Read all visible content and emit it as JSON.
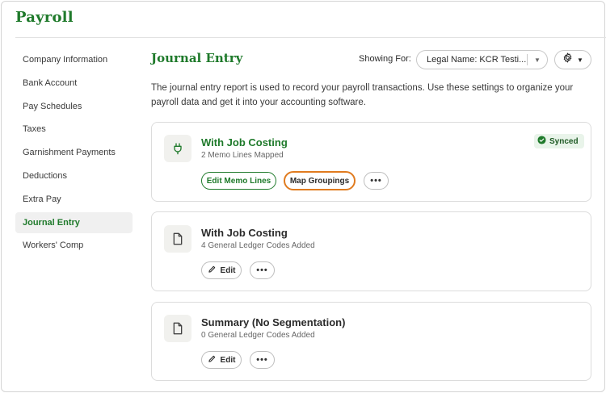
{
  "app": {
    "title": "Payroll"
  },
  "sidebar": {
    "items": [
      {
        "label": "Company Information"
      },
      {
        "label": "Bank Account"
      },
      {
        "label": "Pay Schedules"
      },
      {
        "label": "Taxes"
      },
      {
        "label": "Garnishment Payments"
      },
      {
        "label": "Deductions"
      },
      {
        "label": "Extra Pay"
      },
      {
        "label": "Journal Entry",
        "active": true
      },
      {
        "label": "Workers' Comp"
      }
    ]
  },
  "header": {
    "title": "Journal Entry",
    "showing_for_label": "Showing For:",
    "entity_value": "Legal Name: KCR Testi...",
    "description": "The journal entry report is used to record your payroll transactions. Use these settings to organize your payroll data and get it into your accounting software."
  },
  "cards": [
    {
      "icon": "plug-icon",
      "title": "With Job Costing",
      "subtitle": "2 Memo Lines Mapped",
      "badge": "Synced",
      "actions": {
        "primary": "Edit Memo Lines",
        "secondary": "Map Groupings",
        "more": "•••"
      }
    },
    {
      "icon": "document-icon",
      "title": "With Job Costing",
      "subtitle": "4 General Ledger Codes Added",
      "actions": {
        "edit": "Edit",
        "more": "•••"
      }
    },
    {
      "icon": "document-icon",
      "title": "Summary (No Segmentation)",
      "subtitle": "0 General Ledger Codes Added",
      "actions": {
        "edit": "Edit",
        "more": "•••"
      }
    }
  ],
  "colors": {
    "brand": "#1f7a2b",
    "focus_ring": "#e07b1f",
    "synced_bg": "#e9f4ea"
  }
}
